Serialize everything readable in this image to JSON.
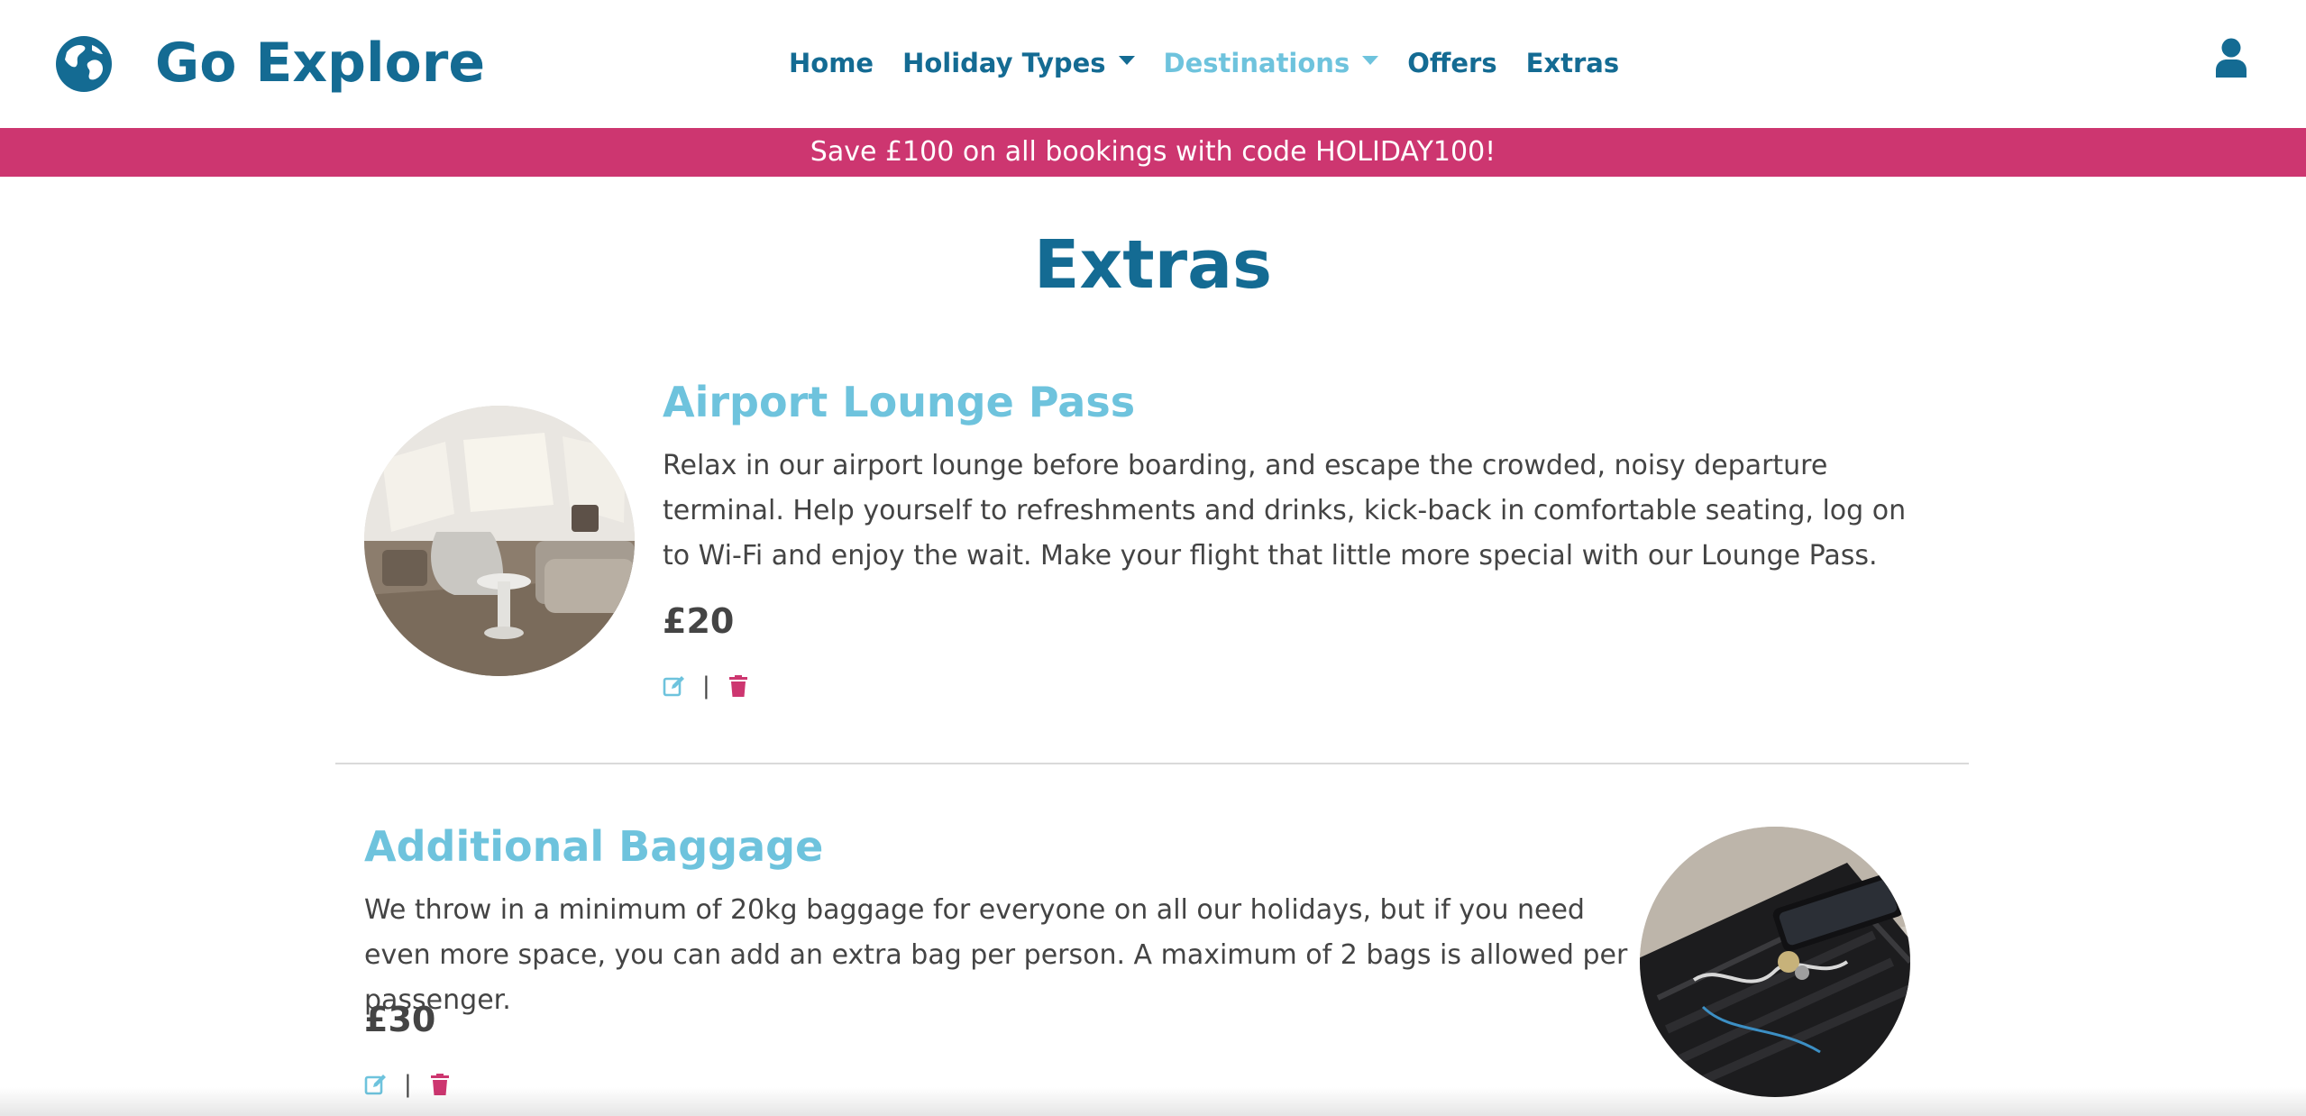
{
  "brand": {
    "name": "Go Explore",
    "logo_icon": "globe-icon"
  },
  "nav": {
    "items": [
      {
        "label": "Home",
        "dropdown": false,
        "active": false
      },
      {
        "label": "Holiday Types",
        "dropdown": true,
        "active": false
      },
      {
        "label": "Destinations",
        "dropdown": true,
        "active": true
      },
      {
        "label": "Offers",
        "dropdown": false,
        "active": false
      },
      {
        "label": "Extras",
        "dropdown": false,
        "active": false
      }
    ],
    "account_icon": "user-icon"
  },
  "promo": {
    "text": "Save £100 on all bookings with code HOLIDAY100!"
  },
  "page": {
    "title": "Extras"
  },
  "extras": [
    {
      "title": "Airport Lounge Pass",
      "description": "Relax in our airport lounge before boarding, and escape the crowded, noisy departure terminal. Help yourself to refreshments and drinks, kick-back in comfortable seating, log on to Wi-Fi and enjoy the wait. Make your flight that little more special with our Lounge Pass.",
      "price": "£20",
      "separator": "|",
      "image_icon": "lounge-photo",
      "edit_icon": "edit-icon",
      "delete_icon": "trash-icon"
    },
    {
      "title": "Additional Baggage",
      "description": "We throw in a minimum of 20kg baggage for everyone on all our holidays, but if you need even more space, you can add an extra bag per person. A maximum of 2 bags is allowed per passenger.",
      "price": "£30",
      "separator": "|",
      "image_icon": "suitcase-photo",
      "edit_icon": "edit-icon",
      "delete_icon": "trash-icon"
    }
  ],
  "colors": {
    "brand": "#146b93",
    "accent": "#6ec3dd",
    "promo": "#cd3670",
    "text": "#444444"
  }
}
